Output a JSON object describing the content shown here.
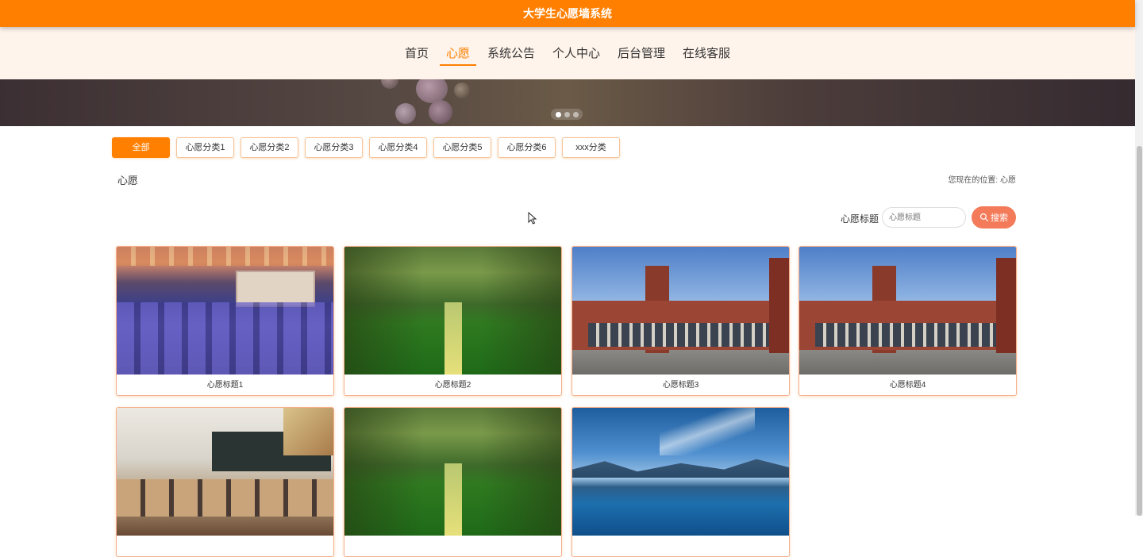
{
  "app": {
    "title": "大学生心愿墙系统"
  },
  "nav": {
    "items": [
      {
        "label": "首页"
      },
      {
        "label": "心愿"
      },
      {
        "label": "系统公告"
      },
      {
        "label": "个人中心"
      },
      {
        "label": "后台管理"
      },
      {
        "label": "在线客服"
      }
    ],
    "active": "心愿"
  },
  "banner": {
    "slide_count": 3,
    "active_slide": 1
  },
  "categories": [
    {
      "label": "全部"
    },
    {
      "label": "心愿分类1"
    },
    {
      "label": "心愿分类2"
    },
    {
      "label": "心愿分类3"
    },
    {
      "label": "心愿分类4"
    },
    {
      "label": "心愿分类5"
    },
    {
      "label": "心愿分类6"
    },
    {
      "label": "xxx分类"
    }
  ],
  "section": {
    "title": "心愿",
    "breadcrumb_prefix": "您现在的位置:",
    "breadcrumb_current": "心愿"
  },
  "search": {
    "label": "心愿标题",
    "placeholder": "心愿标题",
    "button_label": "搜索"
  },
  "wishes": [
    {
      "title": "心愿标题1",
      "image": "lecture-hall"
    },
    {
      "title": "心愿标题2",
      "image": "tree-lined-road"
    },
    {
      "title": "心愿标题3",
      "image": "campus-building"
    },
    {
      "title": "心愿标题4",
      "image": "campus-building"
    },
    {
      "title": "",
      "image": "classroom"
    },
    {
      "title": "",
      "image": "tree-lined-road"
    },
    {
      "title": "",
      "image": "lake-mountains"
    }
  ],
  "colors": {
    "primary": "#ff7f00",
    "nav_bg": "#fff4ec",
    "search_button": "#f37b5a"
  }
}
